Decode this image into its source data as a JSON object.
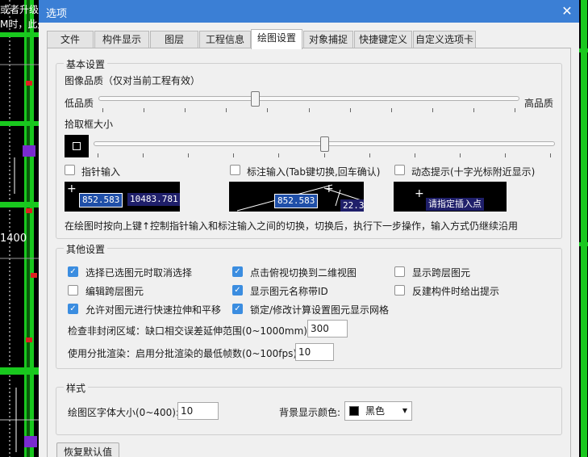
{
  "background": {
    "text_1": "或者升级",
    "text_2": "M时，此处",
    "text_3": "1400"
  },
  "dialog": {
    "title": "选项",
    "close_glyph": "✕"
  },
  "tabs": [
    {
      "label": "文件"
    },
    {
      "label": "构件显示"
    },
    {
      "label": "图层"
    },
    {
      "label": "工程信息"
    },
    {
      "label": "绘图设置",
      "active": true
    },
    {
      "label": "对象捕捉"
    },
    {
      "label": "快捷键定义"
    },
    {
      "label": "自定义选项卡"
    }
  ],
  "basic": {
    "legend": "基本设置",
    "quality_label": "图像品质（仅对当前工程有效）",
    "quality_low": "低品质",
    "quality_high": "高品质",
    "quality_value": 0.37,
    "pickbox_label": "拾取框大小",
    "pickbox_value": 0.5,
    "input_modes": [
      {
        "label": "指针输入",
        "checked": false
      },
      {
        "label": "标注输入(Tab键切换,回车确认)",
        "checked": false
      },
      {
        "label": "动态提示(十字光标附近显示)",
        "checked": false
      }
    ],
    "preview1": {
      "field1": "852.583",
      "field2": "10483.781"
    },
    "preview2": {
      "field1": "852.583",
      "field2": "22.3"
    },
    "preview3": {
      "prompt": "请指定插入点"
    },
    "note": "在绘图时按向上键↑控制指针输入和标注输入之间的切换，切换后，执行下一步操作，输入方式仍继续沿用"
  },
  "other": {
    "legend": "其他设置",
    "options": [
      {
        "label": "选择已选图元时取消选择",
        "checked": true
      },
      {
        "label": "点击俯视切换到二维视图",
        "checked": true
      },
      {
        "label": "显示跨层图元",
        "checked": false
      },
      {
        "label": "编辑跨层图元",
        "checked": false
      },
      {
        "label": "显示图元名称带ID",
        "checked": true
      },
      {
        "label": "反建构件时给出提示",
        "checked": false
      },
      {
        "label": "允许对图元进行快速拉伸和平移",
        "checked": true
      },
      {
        "label": "锁定/修改计算设置图元显示网格",
        "checked": true
      }
    ],
    "check_label": "检查非封闭区域：缺口相交误差延伸范围(0~1000mm):",
    "check_value": "300",
    "batch_label": "使用分批渲染：启用分批渲染的最低帧数(0~100fps):",
    "batch_value": "10"
  },
  "style": {
    "legend": "样式",
    "font_size_label": "绘图区字体大小(0~400):",
    "font_size_value": "10",
    "bg_color_label": "背景显示颜色:",
    "bg_color_value": "黑色",
    "bg_color_hex": "#000000"
  },
  "footer": {
    "restore_label": "恢复默认值"
  },
  "colors": {
    "title_bar": "#3b7fd5",
    "checkbox_checked": "#3b8de0",
    "preview_field": "#1f4fa8",
    "cad_green": "#19c81e",
    "cad_red": "#e02020",
    "cad_purple": "#7a2bd0"
  }
}
